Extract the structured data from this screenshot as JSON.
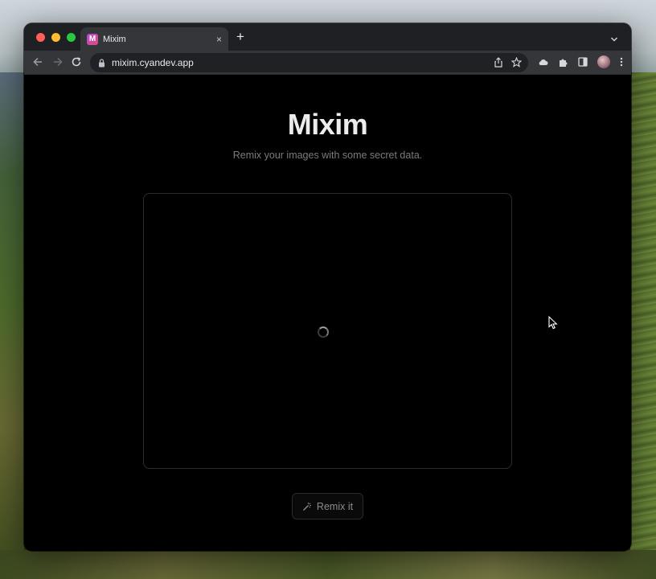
{
  "browser": {
    "tab_title": "Mixim",
    "favicon_letter": "M",
    "tab_close": "×",
    "new_tab": "+",
    "url": "mixim.cyandev.app"
  },
  "page": {
    "title": "Mixim",
    "subtitle": "Remix your images with some secret data.",
    "remix_label": "Remix it"
  },
  "colors": {
    "page_background": "#000000",
    "title": "#ececec",
    "subtitle": "#7b7b7b",
    "button_text": "#8d8d8d",
    "traffic_red": "#ff5f57",
    "traffic_yellow": "#febc2e",
    "traffic_green": "#28c840"
  },
  "icons": {
    "back": "arrow-left-icon",
    "forward": "arrow-right-icon",
    "reload": "reload-icon",
    "lock": "lock-icon",
    "share": "share-icon",
    "bookmark": "star-icon",
    "cloud": "cloud-icon",
    "extensions": "puzzle-icon",
    "side_panel": "side-panel-icon",
    "menu": "kebab-menu-icon",
    "remix": "magic-wand-icon",
    "loading": "spinner-icon"
  }
}
